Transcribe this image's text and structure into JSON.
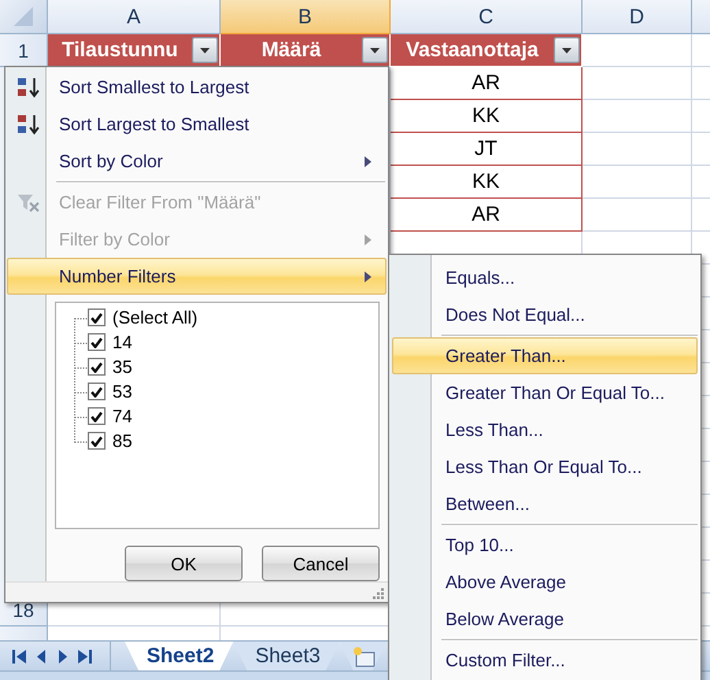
{
  "columns": [
    {
      "label": "A",
      "selected": false
    },
    {
      "label": "B",
      "selected": true
    },
    {
      "label": "C",
      "selected": false
    },
    {
      "label": "D",
      "selected": false
    }
  ],
  "header_row_number": "1",
  "bottom_row_numbers": [
    "18"
  ],
  "header_cells": [
    {
      "label": "Tilaustunnu",
      "filter": true
    },
    {
      "label": "Määrä",
      "filter": true
    },
    {
      "label": "Vastaanottaja",
      "filter": true
    }
  ],
  "rows": [
    {
      "vastaanottaja": "AR"
    },
    {
      "vastaanottaja": "KK"
    },
    {
      "vastaanottaja": "JT"
    },
    {
      "vastaanottaja": "KK"
    },
    {
      "vastaanottaja": "AR"
    }
  ],
  "filter_menu": {
    "items": [
      {
        "kind": "sort_ascending",
        "label": "Sort Smallest to Largest",
        "disabled": false,
        "submenu": false,
        "selected": false
      },
      {
        "kind": "sort_descending",
        "label": "Sort Largest to Smallest",
        "disabled": false,
        "submenu": false,
        "selected": false
      },
      {
        "kind": "plain",
        "label": "Sort by Color",
        "disabled": false,
        "submenu": true,
        "selected": false
      },
      {
        "kind": "separator"
      },
      {
        "kind": "clear_filter",
        "label": "Clear Filter From \"Määrä\"",
        "disabled": true,
        "submenu": false,
        "selected": false
      },
      {
        "kind": "plain",
        "label": "Filter by Color",
        "disabled": true,
        "submenu": true,
        "selected": false
      },
      {
        "kind": "plain",
        "label": "Number Filters",
        "disabled": false,
        "submenu": true,
        "selected": true
      }
    ],
    "values": [
      {
        "label": "(Select All)",
        "checked": true
      },
      {
        "label": "14",
        "checked": true
      },
      {
        "label": "35",
        "checked": true
      },
      {
        "label": "53",
        "checked": true
      },
      {
        "label": "74",
        "checked": true
      },
      {
        "label": "85",
        "checked": true
      }
    ],
    "buttons": [
      "OK",
      "Cancel"
    ]
  },
  "number_filters_menu": {
    "items": [
      {
        "kind": "item",
        "label": "Equals...",
        "selected": false
      },
      {
        "kind": "item",
        "label": "Does Not Equal...",
        "selected": false
      },
      {
        "kind": "separator"
      },
      {
        "kind": "item",
        "label": "Greater Than...",
        "selected": true
      },
      {
        "kind": "item",
        "label": "Greater Than Or Equal To...",
        "selected": false
      },
      {
        "kind": "item",
        "label": "Less Than...",
        "selected": false
      },
      {
        "kind": "item",
        "label": "Less Than Or Equal To...",
        "selected": false
      },
      {
        "kind": "item",
        "label": "Between...",
        "selected": false
      },
      {
        "kind": "separator"
      },
      {
        "kind": "item",
        "label": "Top 10...",
        "selected": false
      },
      {
        "kind": "item",
        "label": "Above Average",
        "selected": false
      },
      {
        "kind": "item",
        "label": "Below Average",
        "selected": false
      },
      {
        "kind": "separator"
      },
      {
        "kind": "item",
        "label": "Custom Filter...",
        "selected": false
      }
    ]
  },
  "sheet_tabs": [
    {
      "label": "Sheet2",
      "selected": true
    },
    {
      "label": "Sheet3",
      "selected": false
    }
  ]
}
